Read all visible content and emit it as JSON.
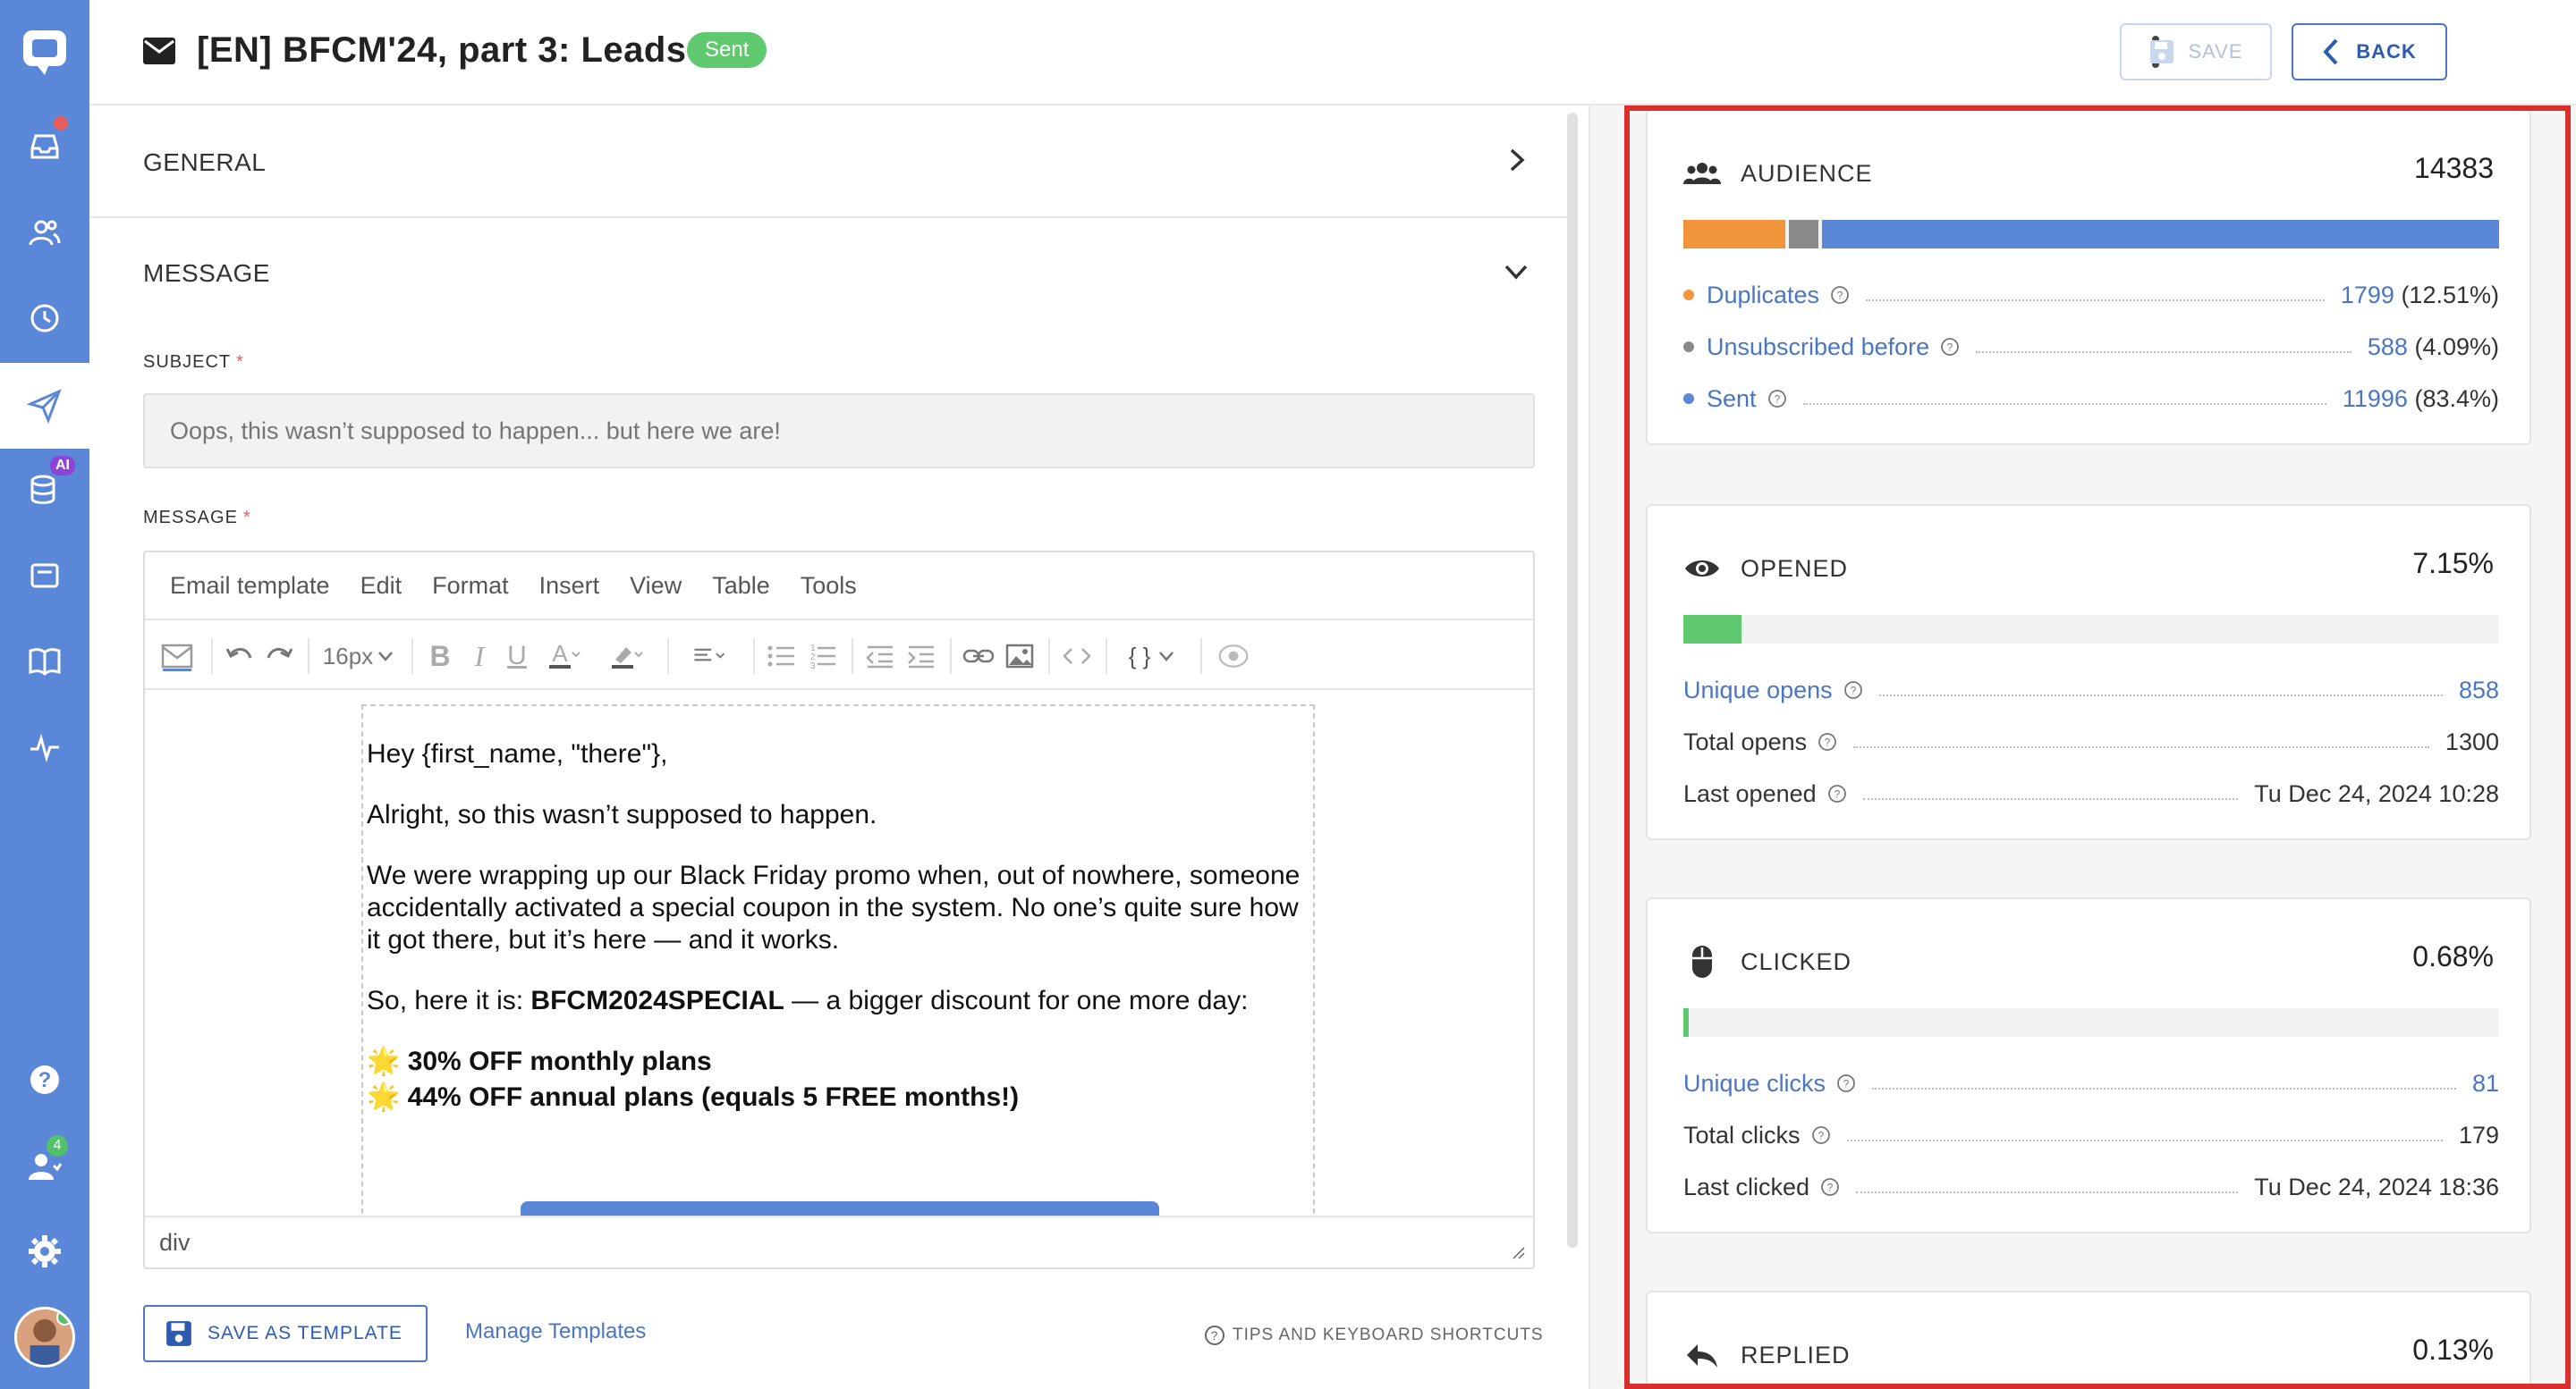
{
  "header": {
    "title": "[EN] BFCM'24, part 3: Leads",
    "status": "Sent",
    "save_label": "SAVE",
    "back_label": "BACK"
  },
  "rail": {
    "ai_badge": "AI",
    "team_count": "4"
  },
  "sections": {
    "general": "GENERAL",
    "message": "MESSAGE"
  },
  "subject": {
    "label": "SUBJECT",
    "required": "*",
    "placeholder": "Oops, this wasn’t supposed to happen... but here we are!"
  },
  "message": {
    "label": "MESSAGE",
    "required": "*"
  },
  "editor": {
    "menu": [
      "Email template",
      "Edit",
      "Format",
      "Insert",
      "View",
      "Table",
      "Tools"
    ],
    "font_size": "16px",
    "code_braces": "{ }",
    "status_path": "div",
    "body": {
      "greeting": "Hey {first_name, \"there\"},",
      "line1": "Alright, so this wasn’t supposed to happen.",
      "line2": "We were wrapping up our Black Friday promo when, out of nowhere, someone accidentally activated a special coupon in the system. No one’s quite sure how it got there, but it’s here — and it works.",
      "line3_prefix": "So, here it is: ",
      "line3_code": "BFCM2024SPECIAL",
      "line3_suffix": " — a bigger discount for one more day:",
      "offer1": "🌟 30% OFF monthly plans",
      "offer2": "🌟 44% OFF annual plans (equals 5 FREE months!)"
    }
  },
  "footer": {
    "save_template": "SAVE AS TEMPLATE",
    "manage_templates": "Manage Templates",
    "tips": "TIPS AND KEYBOARD SHORTCUTS"
  },
  "stats": {
    "audience": {
      "title": "AUDIENCE",
      "value": "14383",
      "segments": [
        {
          "color": "#f0953a",
          "fraction": 0.1251
        },
        {
          "color": "#8a8a8a",
          "fraction": 0.0409
        },
        {
          "color": "#5b87d9",
          "fraction": 0.834
        }
      ],
      "rows": [
        {
          "name": "Duplicates",
          "count": "1799",
          "pct": "(12.51%)",
          "dot": "#f0953a"
        },
        {
          "name": "Unsubscribed before",
          "count": "588",
          "pct": "(4.09%)",
          "dot": "#8a8a8a"
        },
        {
          "name": "Sent",
          "count": "11996",
          "pct": "(83.4%)",
          "dot": "#5b87d9"
        }
      ]
    },
    "opened": {
      "title": "OPENED",
      "value": "7.15%",
      "fraction": 0.0715,
      "color": "#5ec96e",
      "rows": [
        {
          "name": "Unique opens",
          "value": "858"
        },
        {
          "name": "Total opens",
          "value": "1300"
        },
        {
          "name": "Last opened",
          "value": "Tu Dec 24, 2024 10:28"
        }
      ]
    },
    "clicked": {
      "title": "CLICKED",
      "value": "0.68%",
      "fraction": 0.0068,
      "color": "#5ec96e",
      "rows": [
        {
          "name": "Unique clicks",
          "value": "81"
        },
        {
          "name": "Total clicks",
          "value": "179"
        },
        {
          "name": "Last clicked",
          "value": "Tu Dec 24, 2024 18:36"
        }
      ]
    },
    "replied": {
      "title": "REPLIED",
      "value": "0.13%"
    }
  }
}
